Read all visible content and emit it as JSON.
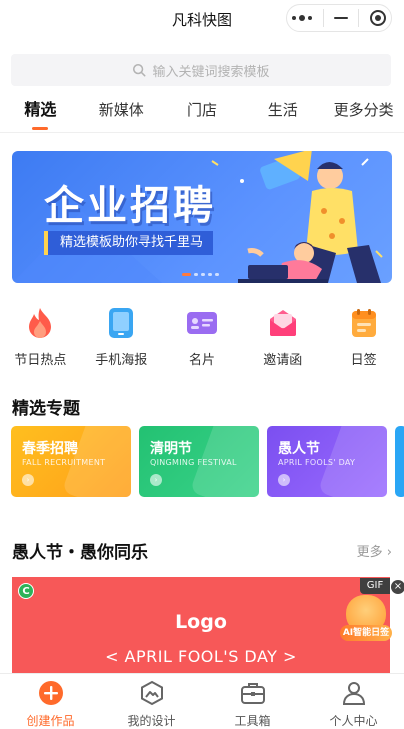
{
  "titlebar": {
    "title": "凡科快图"
  },
  "search": {
    "placeholder": "输入关键词搜索模板"
  },
  "tabs": [
    {
      "label": "精选",
      "active": true
    },
    {
      "label": "新媒体"
    },
    {
      "label": "门店"
    },
    {
      "label": "生活"
    },
    {
      "label": "更多分类"
    }
  ],
  "banner": {
    "headline": "企业招聘",
    "subtitle": "精选模板助你寻找千里马"
  },
  "quick": [
    {
      "label": "节日热点",
      "icon": "flame-icon"
    },
    {
      "label": "手机海报",
      "icon": "phone-icon"
    },
    {
      "label": "名片",
      "icon": "card-icon"
    },
    {
      "label": "邀请函",
      "icon": "envelope-icon"
    },
    {
      "label": "日签",
      "icon": "calendar-icon"
    }
  ],
  "featured": {
    "title": "精选专题",
    "topics": [
      {
        "title": "春季招聘",
        "subtitle": "FALL RECRUITMENT",
        "color": "#ffb11b"
      },
      {
        "title": "清明节",
        "subtitle": "QINGMING FESTIVAL",
        "color": "#27c978"
      },
      {
        "title": "愚人节",
        "subtitle": "APRIL FOOLS' DAY",
        "color": "#7d57ef"
      }
    ]
  },
  "section2": {
    "title": "愚人节・愚你同乐",
    "more": "更多",
    "template": {
      "badge": "C",
      "logo": "Logo",
      "slogan": "< APRIL FOOL'S DAY >",
      "gif_tag": "GIF",
      "close": "×",
      "ai_tag": "AI智能日签"
    }
  },
  "bottom_nav": [
    {
      "label": "创建作品",
      "active": true
    },
    {
      "label": "我的设计"
    },
    {
      "label": "工具箱"
    },
    {
      "label": "个人中心"
    }
  ],
  "colors": {
    "accent": "#ff6a2b",
    "banner": "#3d7bf2",
    "template_bg": "#f75858"
  }
}
